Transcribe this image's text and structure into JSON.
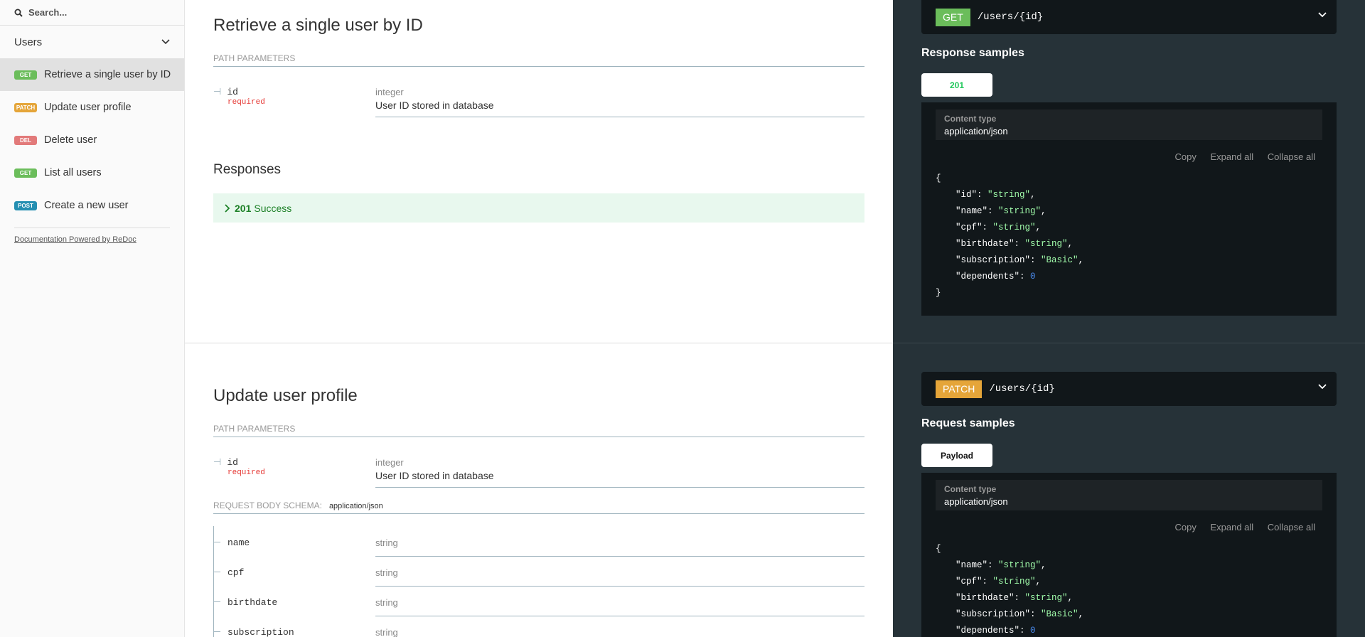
{
  "sidebar": {
    "search_placeholder": "Search...",
    "group_label": "Users",
    "items": [
      {
        "badge": "GET",
        "label": "Retrieve a single user by ID"
      },
      {
        "badge": "PATCH",
        "label": "Update user profile"
      },
      {
        "badge": "DEL",
        "label": "Delete user"
      },
      {
        "badge": "GET",
        "label": "List all users"
      },
      {
        "badge": "POST",
        "label": "Create a new user"
      }
    ],
    "powered_by": "Documentation Powered by ReDoc"
  },
  "op1": {
    "title": "Retrieve a single user by ID",
    "path_params_label": "PATH PARAMETERS",
    "param": {
      "name": "id",
      "required": "required",
      "type": "integer",
      "description": "User ID stored in database"
    },
    "responses_label": "Responses",
    "response": {
      "code": "201",
      "text": "Success"
    },
    "endpoint": {
      "method": "GET",
      "path": "/users/{id}"
    },
    "samples_title": "Response samples",
    "tab": "201",
    "content_type_label": "Content type",
    "content_type": "application/json",
    "actions": {
      "copy": "Copy",
      "expand": "Expand all",
      "collapse": "Collapse all"
    },
    "json_lines": [
      {
        "key": "\"id\"",
        "value": "\"string\"",
        "kind": "s",
        "comma": ","
      },
      {
        "key": "\"name\"",
        "value": "\"string\"",
        "kind": "s",
        "comma": ","
      },
      {
        "key": "\"cpf\"",
        "value": "\"string\"",
        "kind": "s",
        "comma": ","
      },
      {
        "key": "\"birthdate\"",
        "value": "\"string\"",
        "kind": "s",
        "comma": ","
      },
      {
        "key": "\"subscription\"",
        "value": "\"Basic\"",
        "kind": "s",
        "comma": ","
      },
      {
        "key": "\"dependents\"",
        "value": "0",
        "kind": "n",
        "comma": ""
      }
    ],
    "open_brace": "{",
    "close_brace": "}"
  },
  "op2": {
    "title": "Update user profile",
    "path_params_label": "PATH PARAMETERS",
    "param": {
      "name": "id",
      "required": "required",
      "type": "integer",
      "description": "User ID stored in database"
    },
    "body_schema_label": "REQUEST BODY SCHEMA:",
    "body_schema_type": "application/json",
    "body_fields": [
      {
        "name": "name",
        "type": "string"
      },
      {
        "name": "cpf",
        "type": "string"
      },
      {
        "name": "birthdate",
        "type": "string"
      },
      {
        "name": "subscription",
        "type": "string"
      }
    ],
    "endpoint": {
      "method": "PATCH",
      "path": "/users/{id}"
    },
    "samples_title": "Request samples",
    "tab": "Payload",
    "content_type_label": "Content type",
    "content_type": "application/json",
    "actions": {
      "copy": "Copy",
      "expand": "Expand all",
      "collapse": "Collapse all"
    },
    "json_lines": [
      {
        "key": "\"name\"",
        "value": "\"string\"",
        "kind": "s",
        "comma": ","
      },
      {
        "key": "\"cpf\"",
        "value": "\"string\"",
        "kind": "s",
        "comma": ","
      },
      {
        "key": "\"birthdate\"",
        "value": "\"string\"",
        "kind": "s",
        "comma": ","
      },
      {
        "key": "\"subscription\"",
        "value": "\"Basic\"",
        "kind": "s",
        "comma": ","
      },
      {
        "key": "\"dependents\"",
        "value": "0",
        "kind": "n",
        "comma": ""
      }
    ],
    "open_brace": "{"
  }
}
